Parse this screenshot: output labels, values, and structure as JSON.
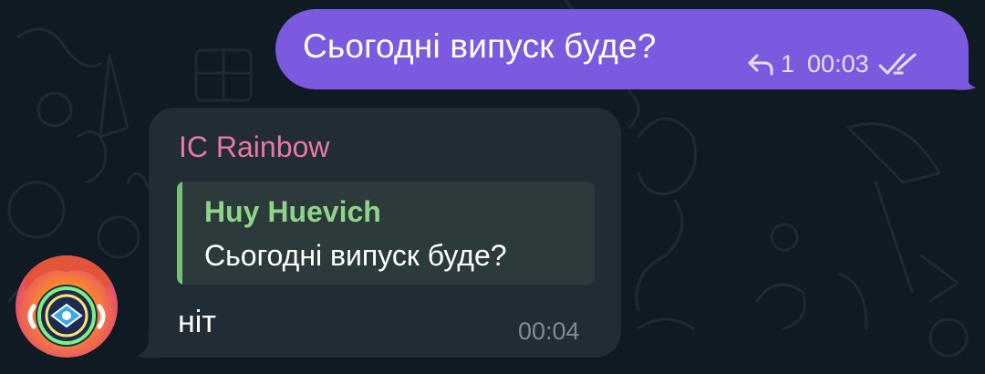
{
  "outgoing_message": {
    "text": "Сьогодні випуск буде?",
    "reply_count": "1",
    "time": "00:03",
    "reply_icon": "reply-arrow-icon",
    "status_icon": "double-check-icon"
  },
  "incoming_message": {
    "sender": "IC Rainbow",
    "quote": {
      "author": "Huy Huevich",
      "text": "Сьогодні випуск буде?"
    },
    "text": "ніт",
    "time": "00:04"
  },
  "avatar": {
    "icon": "avatar-image"
  },
  "colors": {
    "background": "#101a22",
    "outgoing_bubble": "#7b5ae0",
    "incoming_bubble": "#222c35",
    "sender_name": "#e779a4",
    "quote_accent": "#76c071",
    "quote_background": "#2c3a3c"
  }
}
